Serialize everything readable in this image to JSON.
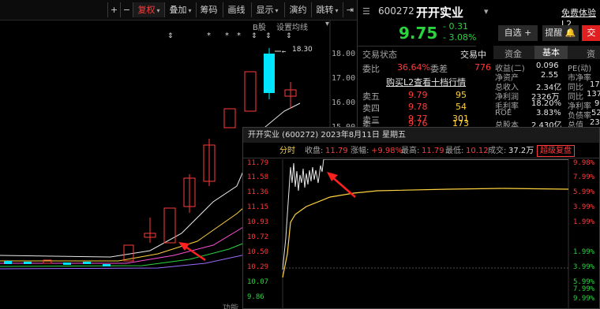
{
  "toolbar": {
    "plus": "+",
    "minus": "−",
    "fuquan": "复权",
    "diejia": "叠加",
    "chouma": "筹码",
    "huaxian": "画线",
    "xianshi": "显示",
    "tongyue": "演约",
    "jiankong": "跳转"
  },
  "kline": {
    "b_marker": "B股",
    "settings": "设置均线",
    "high_tag": "18.30",
    "price_ticks": [
      "18.00",
      "17.00",
      "16.00",
      "15.00"
    ],
    "bottom_hint": "功能"
  },
  "quote": {
    "code": "600272",
    "name": "开开实业",
    "trial": "免费体验L2",
    "price": "9.75",
    "change": "- 0.31",
    "change_pct": "- 3.08%",
    "watch_btn": "自选 +",
    "alert_btn": "提醒",
    "trade_btn": "交",
    "status_label": "交易状态",
    "status_value": "交易中",
    "weibi_label": "委比",
    "weibi_value": "36.64%",
    "weicha_label": "委差",
    "weicha_value": "776",
    "l2_link": "购买L2查看十档行情",
    "asks": [
      {
        "label": "卖五",
        "price": "9.79",
        "vol": "95"
      },
      {
        "label": "卖四",
        "price": "9.78",
        "vol": "54"
      },
      {
        "label": "卖三",
        "price": "9.77",
        "vol": "301"
      },
      {
        "label": "卖二",
        "price": "9.76",
        "vol": "173"
      }
    ]
  },
  "fundamentals": {
    "tabs": [
      "资金",
      "基本",
      "资"
    ],
    "rows": [
      {
        "l": "收益(二)",
        "v": "0.096",
        "l2": "PE(动)",
        "v2": ""
      },
      {
        "l": "净资产",
        "v": "2.55",
        "l2": "市净率",
        "v2": ""
      },
      {
        "l": "总收入",
        "v": "2.34亿",
        "l2": "同比",
        "v2": "17"
      },
      {
        "l": "净利润",
        "v": "2326万",
        "l2": "同比",
        "v2": "137"
      },
      {
        "l": "毛利率",
        "v": "18.20%",
        "l2": "净利率",
        "v2": "9"
      },
      {
        "l": "ROE",
        "v": "3.83%",
        "l2": "负债率",
        "v2": "52"
      },
      {
        "l": "总股本",
        "v": "2.430亿",
        "l2": "总值",
        "v2": "23"
      }
    ]
  },
  "intraday": {
    "title": "开开实业 (600272) 2023年8月11日 星期五",
    "tab": "分时",
    "close_label": "收盘:",
    "close": "11.79",
    "chg_label": "涨幅:",
    "chg": "+9.98%",
    "high_label": "最高:",
    "high": "11.79",
    "low_label": "最低:",
    "low": "10.12",
    "amount_label": "成交:",
    "amount": "37.2万",
    "super_btn": "超级复盘",
    "left_ticks": [
      "11.79",
      "11.58",
      "11.36",
      "11.15",
      "10.93",
      "10.72",
      "10.50",
      "10.29",
      "10.07",
      "9.86"
    ],
    "right_ticks": [
      "9.98%",
      "7.99%",
      "5.99%",
      "3.99%",
      "1.99%",
      "1.99%",
      "3.99%",
      "5.99%",
      "7.99%",
      "9.99%"
    ]
  },
  "colors": {
    "up": "#ff3b3b",
    "down": "#2bd33e",
    "cyan": "#00e5ff",
    "yellow": "#ffd23f"
  }
}
